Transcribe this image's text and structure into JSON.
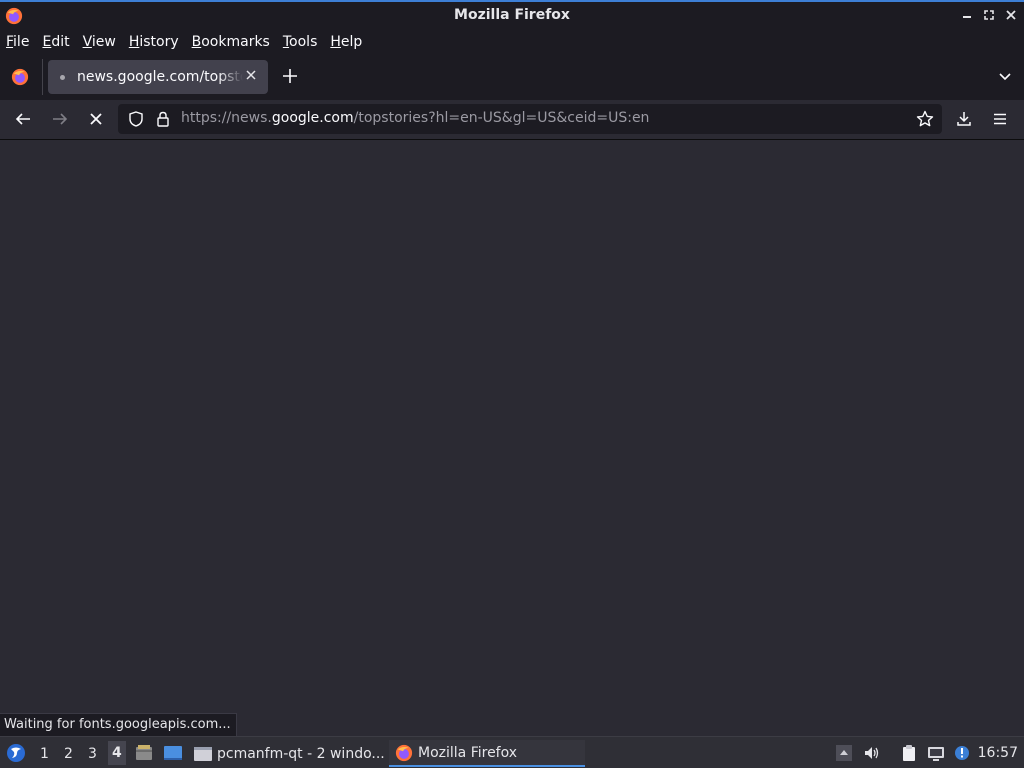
{
  "window": {
    "title": "Mozilla Firefox"
  },
  "menubar": {
    "items": [
      {
        "first": "F",
        "rest": "ile"
      },
      {
        "first": "E",
        "rest": "dit"
      },
      {
        "first": "V",
        "rest": "iew"
      },
      {
        "first": "H",
        "rest": "istory"
      },
      {
        "first": "B",
        "rest": "ookmarks"
      },
      {
        "first": "T",
        "rest": "ools"
      },
      {
        "first": "H",
        "rest": "elp"
      }
    ]
  },
  "tabs": [
    {
      "title": "news.google.com/topstories",
      "active": true
    }
  ],
  "navbar": {
    "url_prefix": "https://news.",
    "url_host": "google.com",
    "url_path": "/topstories?hl=en-US&gl=US&ceid=US:en"
  },
  "status": {
    "text": "Waiting for fonts.googleapis.com..."
  },
  "taskbar": {
    "desktops": [
      "1",
      "2",
      "3",
      "4"
    ],
    "active_desktop": "4",
    "tasks": [
      {
        "label": "pcmanfm-qt - 2 windo...",
        "icon": "window-icon"
      },
      {
        "label": "Mozilla Firefox",
        "icon": "firefox-icon",
        "active": true
      }
    ],
    "clock": "16:57"
  },
  "colors": {
    "accent": "#4a90e2",
    "toolbar": "#2b2a33",
    "chrome": "#1c1b22",
    "url_host": "#fbfbfe",
    "url_muted": "#9b9aa3"
  }
}
